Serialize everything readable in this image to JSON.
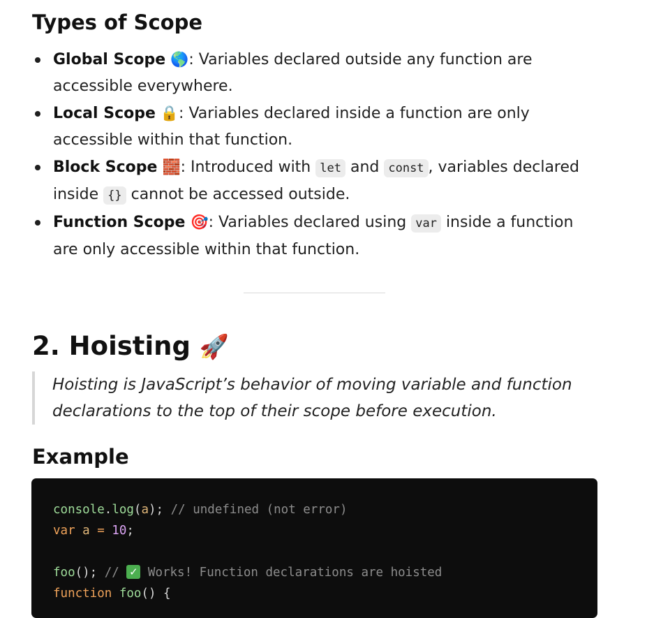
{
  "types_section": {
    "title": "Types of Scope",
    "items": [
      {
        "term": "Global Scope",
        "emoji": "🌎",
        "icon": "globe-icon",
        "text": ": Variables declared outside any function are accessible everywhere."
      },
      {
        "term": "Local Scope",
        "emoji": "🔒",
        "icon": "lock-icon",
        "text": ": Variables declared inside a function are only accessible within that function."
      },
      {
        "term": "Block Scope",
        "emoji": "🧱",
        "icon": "brick-icon",
        "text_1": ": Introduced with ",
        "code_1": "let",
        "text_2": " and ",
        "code_2": "const",
        "text_3": ", variables declared inside ",
        "code_3": "{}",
        "text_4": " cannot be accessed outside."
      },
      {
        "term": "Function Scope",
        "emoji": "🎯",
        "icon": "target-icon",
        "text_1": ": Variables declared using ",
        "code_1": "var",
        "text_2": " inside a function are only accessible within that function."
      }
    ]
  },
  "hoisting_section": {
    "heading": "2. Hoisting",
    "emoji": "🚀",
    "icon": "rocket-icon",
    "definition": "Hoisting is JavaScript’s behavior of moving variable and function declarations to the top of their scope before execution."
  },
  "example_section": {
    "heading": "Example",
    "code": {
      "line1": {
        "obj": "console",
        "dot": ".",
        "method": "log",
        "open": "(",
        "arg": "a",
        "close": ");",
        "comment": " // undefined (not error)"
      },
      "line2": {
        "kw": "var",
        "name": " a",
        "op": " = ",
        "num": "10",
        "end": ";"
      },
      "line4": {
        "call": "foo",
        "paren": "();",
        "comment_pre": " // ",
        "check": "✓",
        "comment_post": " Works! Function declarations are hoisted"
      },
      "line5": {
        "kw": "function",
        "name": " foo",
        "rest": "() {"
      }
    }
  },
  "colors": {
    "code_background": "#0d0d0d",
    "inline_code_background": "#ececec",
    "blockquote_border": "#d6d6d6"
  }
}
